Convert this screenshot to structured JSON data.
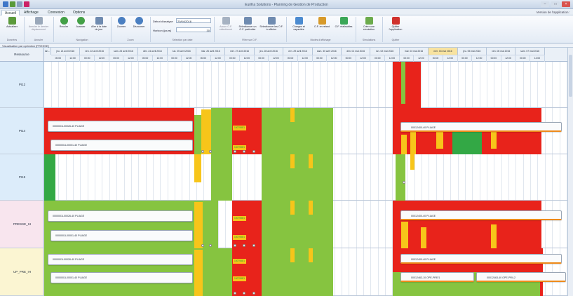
{
  "window": {
    "title": "EuriKa Solutions - Planning de Gestion de Production"
  },
  "menu": {
    "tabs": [
      "Accueil",
      "Affichage",
      "Connexion",
      "Options"
    ],
    "version": "Version de l'application :"
  },
  "ribbon": {
    "buttons": [
      {
        "label": "Actualiser",
        "icon": "refresh-icon"
      },
      {
        "label": "Annuler le dernier déplacement",
        "icon": "undo-icon"
      },
      {
        "label": "Reculer",
        "icon": "back-icon"
      },
      {
        "label": "Avancer",
        "icon": "forward-icon"
      },
      {
        "label": "Aller à la date du jour",
        "icon": "calendar-today-icon"
      },
      {
        "label": "Zoomer",
        "icon": "zoom-in-icon"
      },
      {
        "label": "Dézoomer",
        "icon": "zoom-out-icon"
      },
      {
        "label": "Aucun O.F. sélectionné",
        "icon": "of-none-icon"
      },
      {
        "label": "Sélectionner un O.F. particulier",
        "icon": "of-select-icon"
      },
      {
        "label": "Sélectionner les O.F. à afficher",
        "icon": "of-filter-icon"
      },
      {
        "label": "Charges et capacités",
        "icon": "charge-icon"
      },
      {
        "label": "O.F. en retard",
        "icon": "late-icon"
      },
      {
        "label": "O.F. réalisables",
        "icon": "feasible-icon"
      },
      {
        "label": "Créer une simulation",
        "icon": "simulation-icon"
      },
      {
        "label": "Quitter l'application",
        "icon": "quit-icon"
      }
    ],
    "groups": [
      "Données",
      "Annuler",
      "Navigation",
      "Zoom",
      "Sélection par date",
      "Filtre sur O.F.",
      "Modes d'affichage",
      "Simulations",
      "Quitter"
    ],
    "date_label": "Début d'analyse",
    "date_value": "20/04/2016",
    "horizon_label": "Horizon (jours)",
    "horizon_value": "30"
  },
  "status": {
    "text": "Visualisation par opération [PRESSE]"
  },
  "header": {
    "resource_label": "Ressource",
    "days": [
      "lun...",
      "jeu. 21 avril 2016",
      "ven. 22 avril 2016",
      "sam. 23 avril 2016",
      "dim. 24 avril 2016",
      "lun. 25 avril 2016",
      "mar. 26 avril 2016",
      "mer. 27 avril 2016",
      "jeu. 28 avril 2016",
      "ven. 29 avril 2016",
      "sam. 30 avril 2016",
      "dim. 01 mai 2016",
      "lun. 02 mai 2016",
      "mar. 03 mai 2016",
      "mer. 04 mai 2016",
      "jeu. 05 mai 2016",
      "ven. 06 mai 2016",
      "sam. 07 mai 2016"
    ],
    "hours": [
      "00:00",
      "12:00"
    ]
  },
  "resources": [
    "PI12",
    "PI14",
    "PI15",
    "PRESSE_IH",
    "UP_PRE_IH"
  ],
  "bars": [
    {
      "text": "0000001L00026-40 PLIAGE"
    },
    {
      "text": "0000001L00001-40 PLIAGE"
    },
    {
      "text": "0000001L00026-40 PLIAGE"
    },
    {
      "text": "0000001L00001-40 PLIAGE"
    },
    {
      "text": "0000001L00026-40 PLIAGE"
    },
    {
      "text": "0000001L00001-40 PLIAGE"
    },
    {
      "text": "00012400-40 PLIAGE"
    },
    {
      "text": "00012400-40 PLIAGE"
    },
    {
      "text": "00012400-40 PLIAGE"
    },
    {
      "text": "00012463-10 OPE-PRE/1"
    },
    {
      "text": "00012463-40 OPE-PR/L2"
    }
  ],
  "tags": [
    "1007985/1",
    "1007985/1",
    "1007985/1",
    "1007985/1",
    "1007985/1",
    "1007985/1"
  ],
  "colors": {
    "red": "#e8231b",
    "green": "#86c440",
    "yellow": "#f7c51a",
    "dark_green": "#33a845",
    "orange": "#ee8a1a"
  }
}
